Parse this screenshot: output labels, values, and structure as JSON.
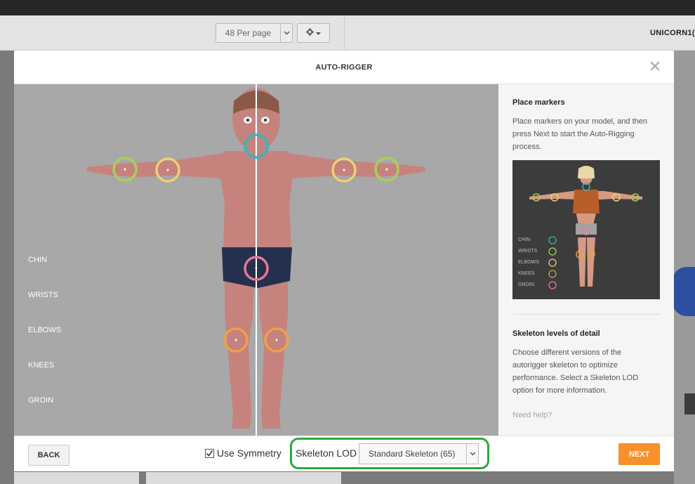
{
  "app": {
    "per_page": "48 Per page",
    "username": "UNICORN1("
  },
  "modal": {
    "title": "AUTO-RIGGER",
    "close_icon": "close-icon",
    "marker_labels": [
      "CHIN",
      "WRISTS",
      "ELBOWS",
      "KNEES",
      "GROIN"
    ],
    "marker_colors": {
      "chin": "#2fb8c0",
      "wrists": "#a6d05a",
      "elbows": "#eed070",
      "knees": "#f0a048",
      "groin": "#e57a9a"
    }
  },
  "sidepanel": {
    "place_title": "Place markers",
    "place_text": "Place markers on your model, and then press Next to start the Auto-Rigging process.",
    "preview_labels": [
      "CHIN",
      "WRISTS",
      "ELBOWS",
      "KNEES",
      "GROIN"
    ],
    "lod_title": "Skeleton levels of detail",
    "lod_text": "Choose different versions of the autorigger skeleton to optimize performance. Select a Skeleton LOD option for more information.",
    "help": "Need help?"
  },
  "footer": {
    "back": "BACK",
    "symmetry_label": "Use Symmetry",
    "symmetry_checked": true,
    "lod_label": "Skeleton LOD",
    "lod_value": "Standard Skeleton (65)",
    "next": "NEXT"
  },
  "colors": {
    "next_button": "#f7902b",
    "lod_highlight": "#2ca83a"
  }
}
